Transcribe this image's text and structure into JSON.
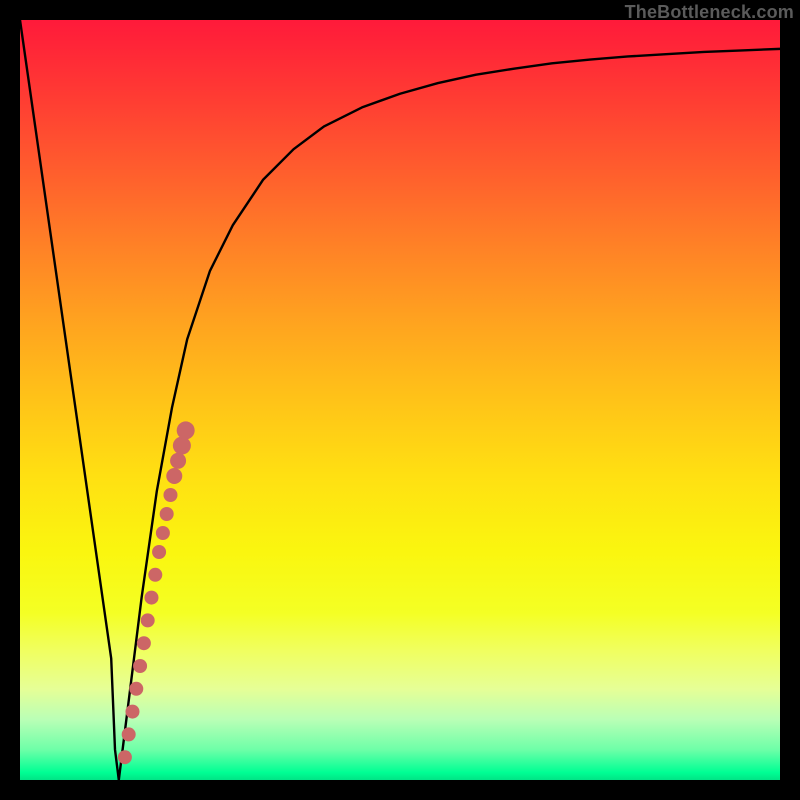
{
  "watermark": "TheBottleneck.com",
  "chart_data": {
    "type": "line",
    "title": "",
    "xlabel": "",
    "ylabel": "",
    "xlim": [
      0,
      100
    ],
    "ylim": [
      0,
      100
    ],
    "grid": false,
    "series": [
      {
        "name": "bottleneck-curve",
        "x": [
          0,
          2,
          4,
          6,
          8,
          10,
          12,
          12.5,
          13,
          14,
          15,
          16,
          18,
          20,
          22,
          25,
          28,
          32,
          36,
          40,
          45,
          50,
          55,
          60,
          65,
          70,
          75,
          80,
          85,
          90,
          95,
          100
        ],
        "y": [
          100,
          86,
          72,
          58,
          44,
          30,
          16,
          4,
          0,
          8,
          16,
          24,
          38,
          49,
          58,
          67,
          73,
          79,
          83,
          86,
          88.5,
          90.3,
          91.7,
          92.8,
          93.6,
          94.3,
          94.8,
          95.2,
          95.5,
          95.8,
          96.0,
          96.2
        ],
        "color": "#000000"
      },
      {
        "name": "highlight-dots",
        "x": [
          13.8,
          14.3,
          14.8,
          15.3,
          15.8,
          16.3,
          16.8,
          17.3,
          17.8,
          18.3,
          18.8,
          19.3,
          19.8,
          20.3,
          20.8,
          21.3,
          21.8
        ],
        "y": [
          3.0,
          6.0,
          9.0,
          12.0,
          15.0,
          18.0,
          21.0,
          24.0,
          27.0,
          30.0,
          32.5,
          35.0,
          37.5,
          40.0,
          42.0,
          44.0,
          46.0
        ],
        "color": "#cc6666",
        "marker_size_px": [
          7,
          7,
          7,
          7,
          7,
          7,
          7,
          7,
          7,
          7,
          7,
          7,
          7,
          8,
          8,
          9,
          9
        ]
      }
    ]
  }
}
